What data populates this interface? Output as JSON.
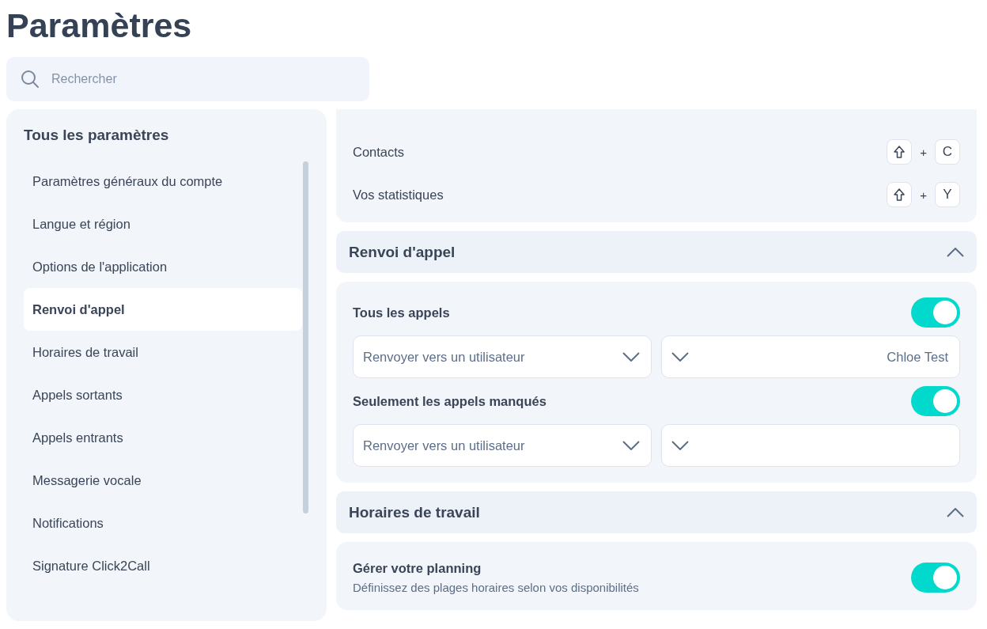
{
  "page": {
    "title": "Paramètres"
  },
  "search": {
    "placeholder": "Rechercher"
  },
  "sidebar": {
    "heading": "Tous les paramètres",
    "items": [
      {
        "label": "Paramètres généraux du compte",
        "selected": false
      },
      {
        "label": "Langue et région",
        "selected": false
      },
      {
        "label": "Options de l'application",
        "selected": false
      },
      {
        "label": "Renvoi d'appel",
        "selected": true
      },
      {
        "label": "Horaires de travail",
        "selected": false
      },
      {
        "label": "Appels sortants",
        "selected": false
      },
      {
        "label": "Appels entrants",
        "selected": false
      },
      {
        "label": "Messagerie vocale",
        "selected": false
      },
      {
        "label": "Notifications",
        "selected": false
      },
      {
        "label": "Signature Click2Call",
        "selected": false
      }
    ]
  },
  "shortcuts": [
    {
      "label": "Contacts",
      "plus": "+",
      "key": "C"
    },
    {
      "label": "Vos statistiques",
      "plus": "+",
      "key": "Y"
    }
  ],
  "sections": [
    {
      "kind": "forwarding",
      "title": "Renvoi d'appel",
      "expanded": true,
      "rules": [
        {
          "label": "Tous les appels",
          "on": true,
          "target_type": "Renvoyer vers un utilisateur",
          "target": "Chloe Test"
        },
        {
          "label": "Seulement les appels manqués",
          "on": true,
          "target_type": "Renvoyer vers un utilisateur"
        }
      ]
    },
    {
      "kind": "schedule",
      "title": "Horaires de travail",
      "expanded": true,
      "planning": {
        "label": "Gérer votre planning",
        "description": "Définissez des plages horaires selon vos disponibilités",
        "on": true
      }
    }
  ]
}
